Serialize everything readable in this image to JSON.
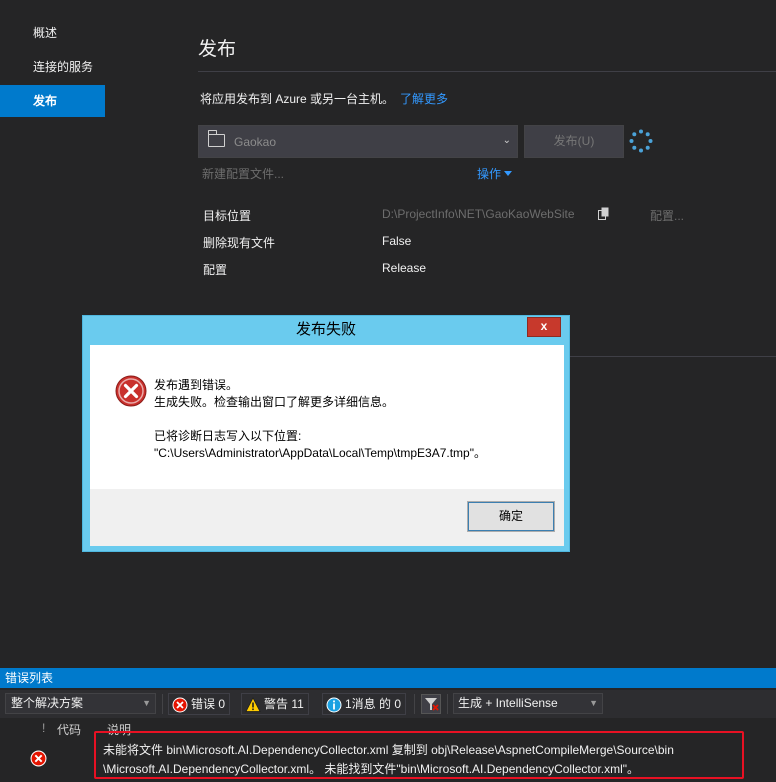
{
  "nav": {
    "items": [
      "概述",
      "连接的服务",
      "发布"
    ],
    "active_index": 2
  },
  "publish": {
    "title": "发布",
    "intro_text": "将应用发布到 Azure 或另一台主机。",
    "learn_more": "了解更多",
    "profile_name": "Gaokao",
    "publish_button": "发布(U)",
    "new_profile": "新建配置文件...",
    "actions": "操作",
    "properties": [
      {
        "label": "目标位置",
        "value": "D:\\ProjectInfo\\NET\\GaoKaoWebSite"
      },
      {
        "label": "删除现有文件",
        "value": "False"
      },
      {
        "label": "配置",
        "value": "Release"
      }
    ],
    "config_link": "配置..."
  },
  "dialog": {
    "title": "发布失败",
    "close_label": "x",
    "line1": "发布遇到错误。",
    "line2": "生成失败。检查输出窗口了解更多详细信息。",
    "line3": "已将诊断日志写入以下位置:",
    "line4": "\"C:\\Users\\Administrator\\AppData\\Local\\Temp\\tmpE3A7.tmp\"。",
    "ok_label": "确定"
  },
  "error_list": {
    "title": "错误列表",
    "scope": "整个解决方案",
    "errors_label": "错误 0",
    "warnings_label": "警告 11",
    "messages_label": "1消息 的 0",
    "build_filter": "生成 + IntelliSense",
    "col_code": "代码",
    "col_desc": "说明",
    "rows": [
      {
        "desc_line1": "未能将文件 bin\\Microsoft.AI.DependencyCollector.xml 复制到 obj\\Release\\AspnetCompileMerge\\Source\\bin",
        "desc_line2": "\\Microsoft.AI.DependencyCollector.xml。 未能找到文件\"bin\\Microsoft.AI.DependencyCollector.xml\"。"
      }
    ]
  },
  "colors": {
    "accent": "#007acc",
    "link": "#3399ff",
    "error": "#e81123",
    "dialog_frame": "#6acbee"
  }
}
